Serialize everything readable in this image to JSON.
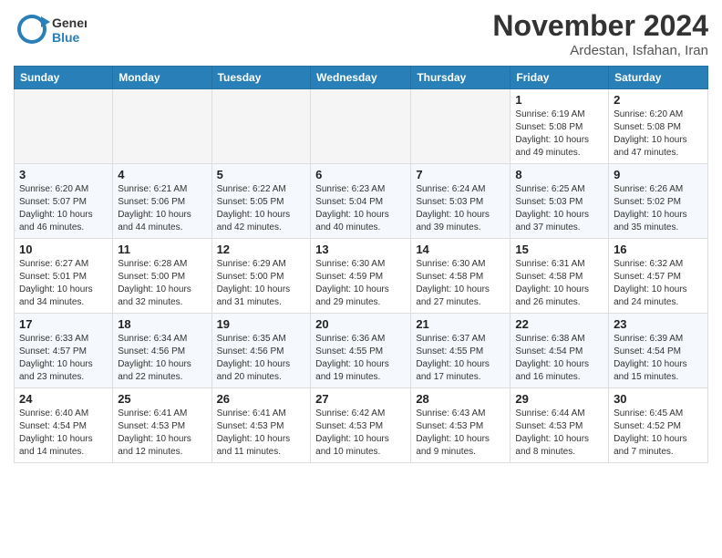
{
  "header": {
    "logo_line1": "General",
    "logo_line2": "Blue",
    "month_title": "November 2024",
    "location": "Ardestan, Isfahan, Iran"
  },
  "weekdays": [
    "Sunday",
    "Monday",
    "Tuesday",
    "Wednesday",
    "Thursday",
    "Friday",
    "Saturday"
  ],
  "weeks": [
    [
      {
        "day": "",
        "info": ""
      },
      {
        "day": "",
        "info": ""
      },
      {
        "day": "",
        "info": ""
      },
      {
        "day": "",
        "info": ""
      },
      {
        "day": "",
        "info": ""
      },
      {
        "day": "1",
        "info": "Sunrise: 6:19 AM\nSunset: 5:08 PM\nDaylight: 10 hours\nand 49 minutes."
      },
      {
        "day": "2",
        "info": "Sunrise: 6:20 AM\nSunset: 5:08 PM\nDaylight: 10 hours\nand 47 minutes."
      }
    ],
    [
      {
        "day": "3",
        "info": "Sunrise: 6:20 AM\nSunset: 5:07 PM\nDaylight: 10 hours\nand 46 minutes."
      },
      {
        "day": "4",
        "info": "Sunrise: 6:21 AM\nSunset: 5:06 PM\nDaylight: 10 hours\nand 44 minutes."
      },
      {
        "day": "5",
        "info": "Sunrise: 6:22 AM\nSunset: 5:05 PM\nDaylight: 10 hours\nand 42 minutes."
      },
      {
        "day": "6",
        "info": "Sunrise: 6:23 AM\nSunset: 5:04 PM\nDaylight: 10 hours\nand 40 minutes."
      },
      {
        "day": "7",
        "info": "Sunrise: 6:24 AM\nSunset: 5:03 PM\nDaylight: 10 hours\nand 39 minutes."
      },
      {
        "day": "8",
        "info": "Sunrise: 6:25 AM\nSunset: 5:03 PM\nDaylight: 10 hours\nand 37 minutes."
      },
      {
        "day": "9",
        "info": "Sunrise: 6:26 AM\nSunset: 5:02 PM\nDaylight: 10 hours\nand 35 minutes."
      }
    ],
    [
      {
        "day": "10",
        "info": "Sunrise: 6:27 AM\nSunset: 5:01 PM\nDaylight: 10 hours\nand 34 minutes."
      },
      {
        "day": "11",
        "info": "Sunrise: 6:28 AM\nSunset: 5:00 PM\nDaylight: 10 hours\nand 32 minutes."
      },
      {
        "day": "12",
        "info": "Sunrise: 6:29 AM\nSunset: 5:00 PM\nDaylight: 10 hours\nand 31 minutes."
      },
      {
        "day": "13",
        "info": "Sunrise: 6:30 AM\nSunset: 4:59 PM\nDaylight: 10 hours\nand 29 minutes."
      },
      {
        "day": "14",
        "info": "Sunrise: 6:30 AM\nSunset: 4:58 PM\nDaylight: 10 hours\nand 27 minutes."
      },
      {
        "day": "15",
        "info": "Sunrise: 6:31 AM\nSunset: 4:58 PM\nDaylight: 10 hours\nand 26 minutes."
      },
      {
        "day": "16",
        "info": "Sunrise: 6:32 AM\nSunset: 4:57 PM\nDaylight: 10 hours\nand 24 minutes."
      }
    ],
    [
      {
        "day": "17",
        "info": "Sunrise: 6:33 AM\nSunset: 4:57 PM\nDaylight: 10 hours\nand 23 minutes."
      },
      {
        "day": "18",
        "info": "Sunrise: 6:34 AM\nSunset: 4:56 PM\nDaylight: 10 hours\nand 22 minutes."
      },
      {
        "day": "19",
        "info": "Sunrise: 6:35 AM\nSunset: 4:56 PM\nDaylight: 10 hours\nand 20 minutes."
      },
      {
        "day": "20",
        "info": "Sunrise: 6:36 AM\nSunset: 4:55 PM\nDaylight: 10 hours\nand 19 minutes."
      },
      {
        "day": "21",
        "info": "Sunrise: 6:37 AM\nSunset: 4:55 PM\nDaylight: 10 hours\nand 17 minutes."
      },
      {
        "day": "22",
        "info": "Sunrise: 6:38 AM\nSunset: 4:54 PM\nDaylight: 10 hours\nand 16 minutes."
      },
      {
        "day": "23",
        "info": "Sunrise: 6:39 AM\nSunset: 4:54 PM\nDaylight: 10 hours\nand 15 minutes."
      }
    ],
    [
      {
        "day": "24",
        "info": "Sunrise: 6:40 AM\nSunset: 4:54 PM\nDaylight: 10 hours\nand 14 minutes."
      },
      {
        "day": "25",
        "info": "Sunrise: 6:41 AM\nSunset: 4:53 PM\nDaylight: 10 hours\nand 12 minutes."
      },
      {
        "day": "26",
        "info": "Sunrise: 6:41 AM\nSunset: 4:53 PM\nDaylight: 10 hours\nand 11 minutes."
      },
      {
        "day": "27",
        "info": "Sunrise: 6:42 AM\nSunset: 4:53 PM\nDaylight: 10 hours\nand 10 minutes."
      },
      {
        "day": "28",
        "info": "Sunrise: 6:43 AM\nSunset: 4:53 PM\nDaylight: 10 hours\nand 9 minutes."
      },
      {
        "day": "29",
        "info": "Sunrise: 6:44 AM\nSunset: 4:53 PM\nDaylight: 10 hours\nand 8 minutes."
      },
      {
        "day": "30",
        "info": "Sunrise: 6:45 AM\nSunset: 4:52 PM\nDaylight: 10 hours\nand 7 minutes."
      }
    ]
  ]
}
